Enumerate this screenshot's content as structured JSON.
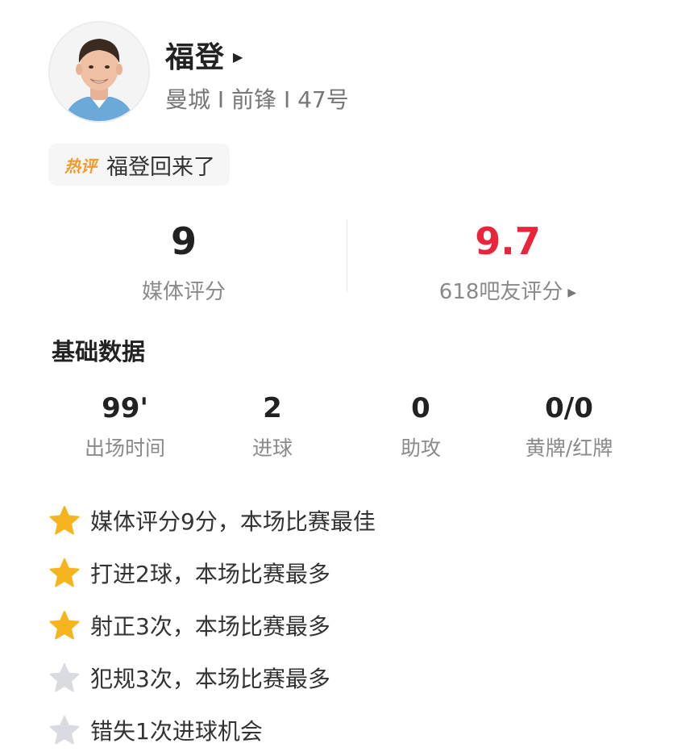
{
  "player": {
    "name": "福登",
    "meta": "曼城 I 前锋 I 47号"
  },
  "hot_comment": {
    "tag": "热评",
    "text": "福登回来了"
  },
  "scores": {
    "media_score": "9",
    "media_label": "媒体评分",
    "fan_score": "9.7",
    "fan_label": "618吧友评分"
  },
  "basic": {
    "title": "基础数据",
    "stats": [
      {
        "value": "99'",
        "label": "出场时间"
      },
      {
        "value": "2",
        "label": "进球"
      },
      {
        "value": "0",
        "label": "助攻"
      },
      {
        "value": "0/0",
        "label": "黄牌/红牌"
      }
    ]
  },
  "highlights": [
    {
      "text": "媒体评分9分，本场比赛最佳",
      "star": "gold-star-icon"
    },
    {
      "text": "打进2球，本场比赛最多",
      "star": "gold-star-icon"
    },
    {
      "text": "射正3次，本场比赛最多",
      "star": "gold-star-icon"
    },
    {
      "text": "犯规3次，本场比赛最多",
      "star": "gray-star-icon"
    },
    {
      "text": "错失1次进球机会",
      "star": "gray-star-icon"
    }
  ],
  "colors": {
    "fan_score_red": "#e8253a",
    "hot_tag_orange": "#f39a2b",
    "star_gold": "#f6b51e",
    "star_gray": "#d9dbe0"
  }
}
